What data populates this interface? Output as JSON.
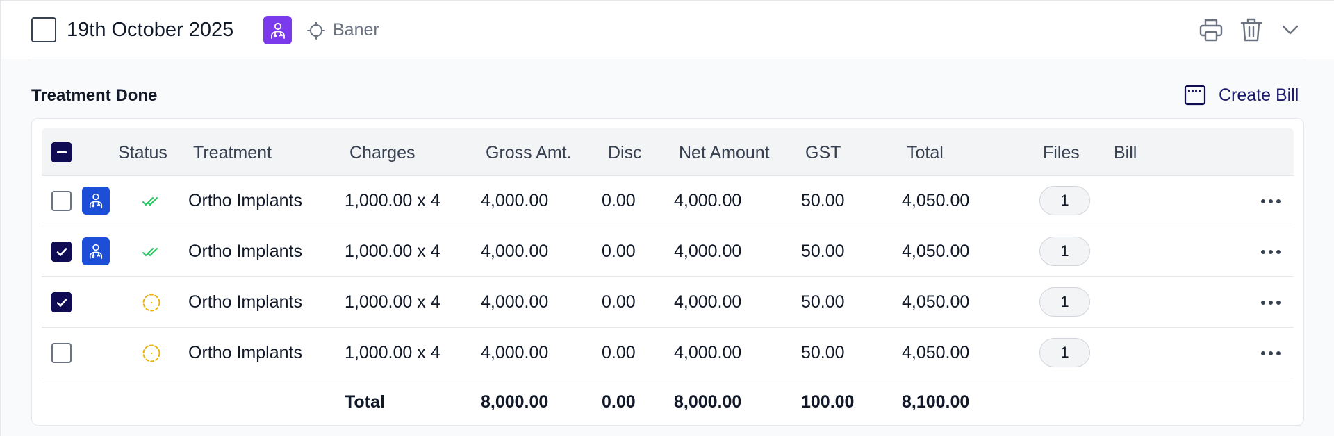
{
  "header": {
    "date": "19th October 2025",
    "location": "Baner"
  },
  "section": {
    "title": "Treatment Done",
    "create_bill_label": "Create Bill"
  },
  "table": {
    "columns": {
      "status": "Status",
      "treatment": "Treatment",
      "charges": "Charges",
      "gross": "Gross Amt.",
      "disc": "Disc",
      "net": "Net Amount",
      "gst": "GST",
      "total": "Total",
      "files": "Files",
      "bill": "Bill"
    },
    "rows": [
      {
        "checked": false,
        "doctor_badge": true,
        "status": "done",
        "treatment": "Ortho Implants",
        "charges": "1,000.00 x 4",
        "gross": "4,000.00",
        "disc": "0.00",
        "net": "4,000.00",
        "gst": "50.00",
        "total": "4,050.00",
        "files": "1"
      },
      {
        "checked": true,
        "doctor_badge": true,
        "status": "done",
        "treatment": "Ortho Implants",
        "charges": "1,000.00 x 4",
        "gross": "4,000.00",
        "disc": "0.00",
        "net": "4,000.00",
        "gst": "50.00",
        "total": "4,050.00",
        "files": "1"
      },
      {
        "checked": true,
        "doctor_badge": false,
        "status": "pending",
        "treatment": "Ortho Implants",
        "charges": "1,000.00 x 4",
        "gross": "4,000.00",
        "disc": "0.00",
        "net": "4,000.00",
        "gst": "50.00",
        "total": "4,050.00",
        "files": "1"
      },
      {
        "checked": false,
        "doctor_badge": false,
        "status": "pending",
        "treatment": "Ortho Implants",
        "charges": "1,000.00 x 4",
        "gross": "4,000.00",
        "disc": "0.00",
        "net": "4,000.00",
        "gst": "50.00",
        "total": "4,050.00",
        "files": "1"
      }
    ],
    "totals": {
      "label": "Total",
      "gross": "8,000.00",
      "disc": "0.00",
      "net": "8,000.00",
      "gst": "100.00",
      "total": "8,100.00"
    }
  },
  "icons": {
    "doctor": "doctor-icon",
    "location": "crosshair-icon",
    "print": "printer-icon",
    "delete": "trash-icon",
    "expand": "chevron-down-icon",
    "create_bill": "bill-icon",
    "status_done": "double-check-icon",
    "status_pending": "dashed-circle-icon",
    "more": "more-horizontal-icon"
  },
  "colors": {
    "primary": "#0f0c54",
    "header_badge": "#7c3aed",
    "row_badge": "#1d4ed8",
    "done": "#22c55e",
    "pending": "#eab308"
  }
}
